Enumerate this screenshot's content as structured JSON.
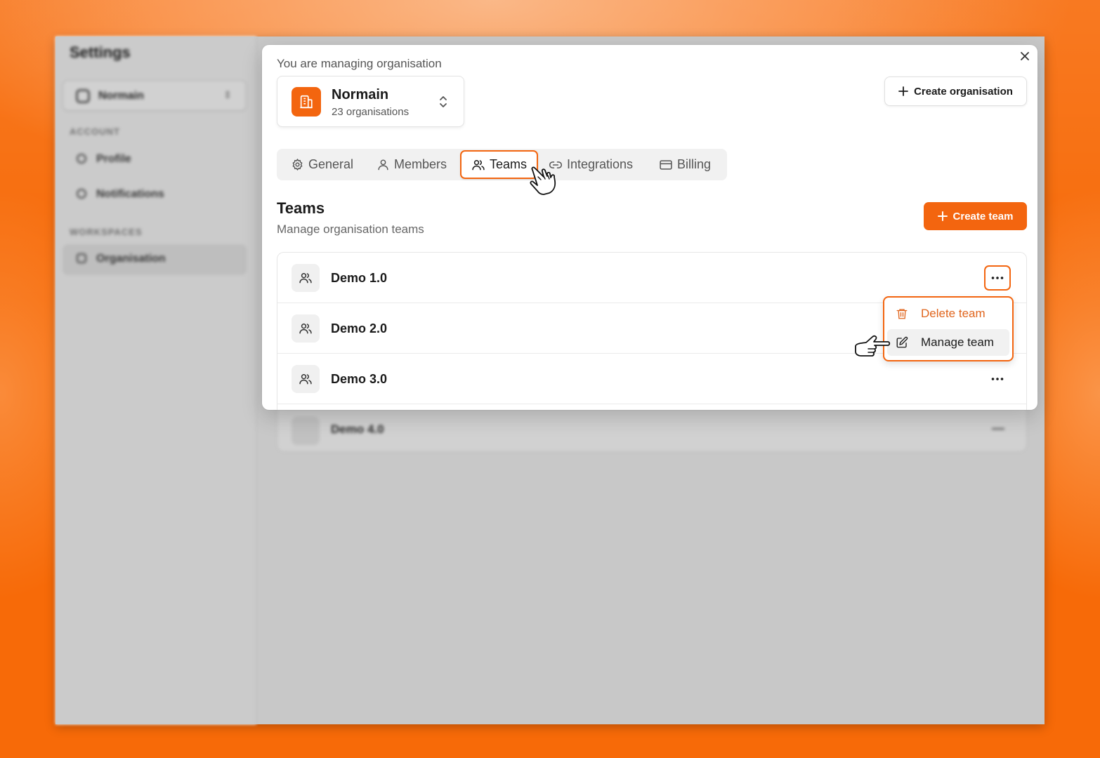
{
  "background_window": {
    "title": "Settings",
    "org_select": "Normain",
    "sections": {
      "account": "ACCOUNT",
      "workspaces": "WORKSPACES"
    },
    "nav": {
      "profile": "Profile",
      "notifications": "Notifications",
      "organisation": "Organisation"
    },
    "hidden_team": {
      "name": "Demo 4.0"
    }
  },
  "modal": {
    "managing_label": "You are managing organisation",
    "org": {
      "name": "Normain",
      "count": "23 organisations"
    },
    "create_org_label": "Create organisation",
    "tabs": [
      {
        "label": "General",
        "icon": "gear-icon"
      },
      {
        "label": "Members",
        "icon": "user-icon"
      },
      {
        "label": "Teams",
        "icon": "users-icon",
        "active": true
      },
      {
        "label": "Integrations",
        "icon": "link-icon"
      },
      {
        "label": "Billing",
        "icon": "card-icon"
      }
    ],
    "teams_section": {
      "title": "Teams",
      "subtitle": "Manage organisation teams",
      "create_label": "Create team"
    },
    "teams": [
      {
        "name": "Demo 1.0"
      },
      {
        "name": "Demo 2.0"
      },
      {
        "name": "Demo 3.0"
      }
    ],
    "dropdown": {
      "delete_label": "Delete team",
      "manage_label": "Manage team"
    }
  },
  "colors": {
    "accent": "#f3650f",
    "background": "#f76a08",
    "danger_text": "#e0651d"
  }
}
